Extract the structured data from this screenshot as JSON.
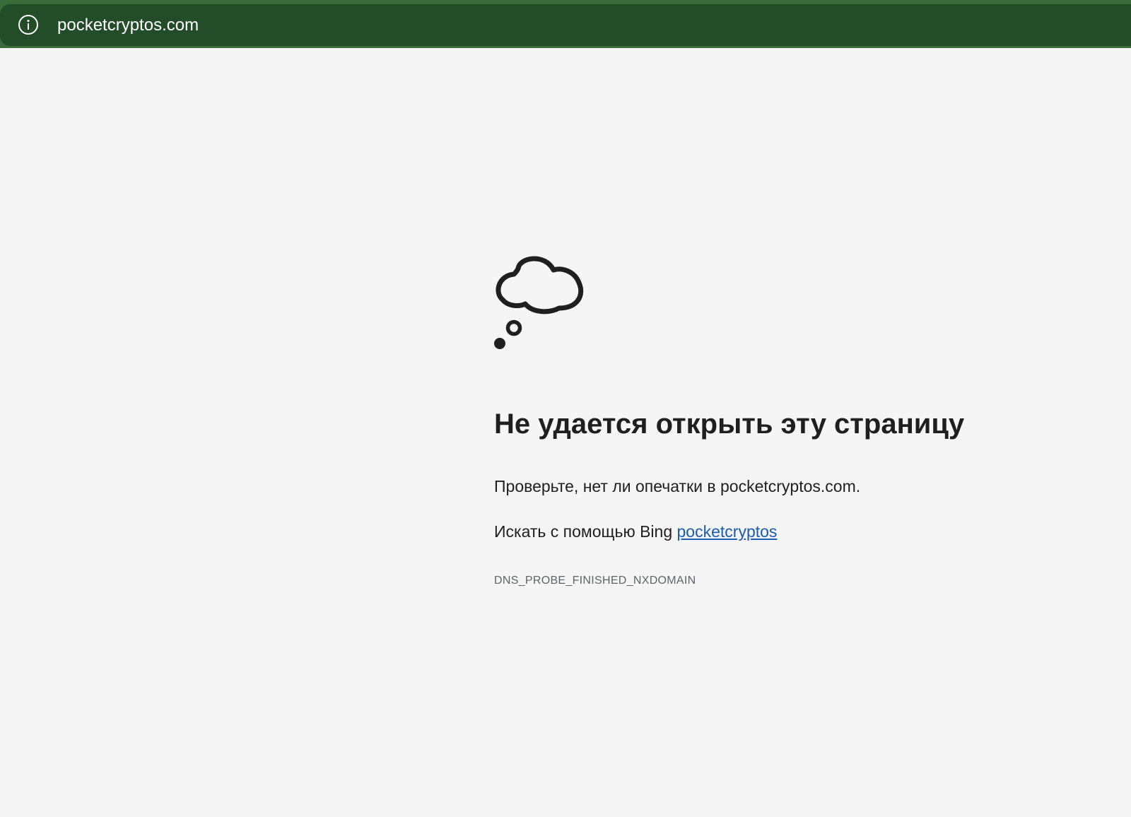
{
  "browser": {
    "url": "pocketcryptos.com",
    "site_info_icon": "info-icon",
    "colors": {
      "toolbar": "#3a6b3a",
      "address_bar": "#234d29"
    }
  },
  "error_page": {
    "icon": "thought-cloud-icon",
    "title": "Не удается открыть эту страницу",
    "message": "Проверьте, нет ли опечатки в pocketcryptos.com.",
    "search_prefix": "Искать с помощью Bing",
    "search_link": "pocketcryptos",
    "error_code": "DNS_PROBE_FINISHED_NXDOMAIN",
    "colors": {
      "background": "#f5f5f5",
      "link": "#1a5bb3"
    }
  }
}
